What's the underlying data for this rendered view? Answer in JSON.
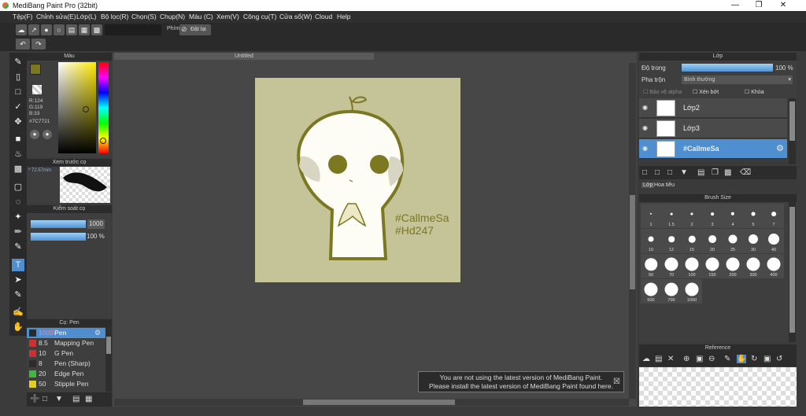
{
  "window": {
    "title": "MediBang Paint Pro (32bit)"
  },
  "menu": [
    "Tệp(F)",
    "Chỉnh sửa(E)",
    "Lớp(L)",
    "Bộ lọc(R)",
    "Chọn(S)",
    "Chụp(N)",
    "Màu (C)",
    "Xem(V)",
    "Công cụ(T)",
    "Cửa sổ(W)",
    "Cloud",
    "Help"
  ],
  "toolbar": {
    "snap_label": "Phím",
    "snap_button": "Đặt lại"
  },
  "color_panel": {
    "title": "Màu",
    "r": "R:124",
    "g": "G:119",
    "b": "B:33",
    "hex": "#7C7721",
    "primary": "#7c7721",
    "secondary": "#c5c398"
  },
  "brush_preview": {
    "title": "Xem trước cọ",
    "size": "* 72.57mm"
  },
  "brush_control": {
    "title": "Kiểm soát cọ",
    "size_value": "1000",
    "opacity_value": "100 %"
  },
  "brush_list": {
    "title": "Cọ: Pen",
    "items": [
      {
        "size": "1000",
        "name": "Pen",
        "color": "#2b2b2b",
        "selected": true
      },
      {
        "size": "8.5",
        "name": "Mapping Pen",
        "color": "#d03030"
      },
      {
        "size": "10",
        "name": "G Pen",
        "color": "#d03030"
      },
      {
        "size": "8",
        "name": "Pen (Sharp)",
        "color": "#2b2b2b"
      },
      {
        "size": "20",
        "name": "Edge Pen",
        "color": "#3cba3c"
      },
      {
        "size": "50",
        "name": "Stipple Pen",
        "color": "#e2d020"
      }
    ]
  },
  "document": {
    "tab_title": "Untitled",
    "text1": "#CallmeSa",
    "text2": "#Hd247"
  },
  "notice": {
    "line1": "You are not using the latest version of MediBang Paint.",
    "line2": "Please install the latest version of MediBang Paint found here."
  },
  "layer_panel": {
    "title": "Lớp",
    "opacity_label": "Độ trong",
    "opacity_value": "100 %",
    "blend_label": "Pha trộn",
    "blend_value": "Bình thường",
    "protect_alpha": "Bảo vệ alpha",
    "clipping": "Xén bớt",
    "lock": "Khóa",
    "layers": [
      {
        "name": "Lớp2",
        "selected": false
      },
      {
        "name": "Lớp3",
        "selected": false
      },
      {
        "name": "#CallmeSa",
        "selected": true
      }
    ],
    "tabs": [
      "Lớp",
      "Hoa tiêu"
    ]
  },
  "brush_size": {
    "title": "Brush Size",
    "sizes": [
      "1",
      "1.5",
      "2",
      "3",
      "4",
      "5",
      "7",
      "10",
      "12",
      "15",
      "20",
      "25",
      "30",
      "40",
      "50",
      "70",
      "100",
      "150",
      "200",
      "300",
      "400",
      "500",
      "700",
      "1000"
    ]
  },
  "reference": {
    "title": "Reference"
  }
}
